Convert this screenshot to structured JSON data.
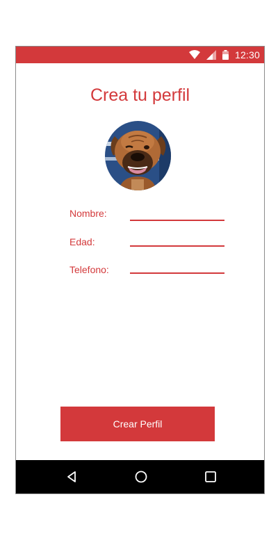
{
  "status_bar": {
    "time": "12:30",
    "icons": [
      "wifi-icon",
      "signal-icon",
      "battery-icon"
    ],
    "color": "#d3393b"
  },
  "title": "Crea tu perfil",
  "avatar": {
    "icon": "dog-photo"
  },
  "form": {
    "fields": [
      {
        "label": "Nombre:",
        "value": ""
      },
      {
        "label": "Edad:",
        "value": ""
      },
      {
        "label": "Telefono:",
        "value": ""
      }
    ]
  },
  "submit_label": "Crear Perfil",
  "nav": {
    "buttons": [
      "back-icon",
      "home-icon",
      "recents-icon"
    ]
  },
  "colors": {
    "accent": "#d3393b",
    "nav_background": "#000000"
  }
}
